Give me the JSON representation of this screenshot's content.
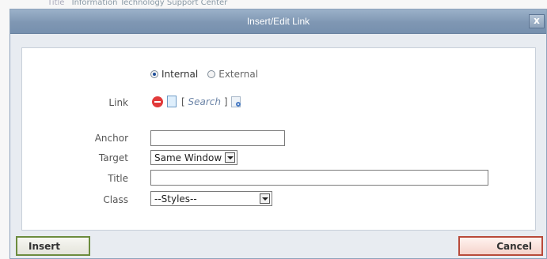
{
  "background": {
    "field_label": "Title",
    "field_value": "Information Technology Support Center"
  },
  "dialog": {
    "title": "Insert/Edit Link",
    "close_symbol": "x"
  },
  "link_type": {
    "options": [
      {
        "label": "Internal",
        "selected": true
      },
      {
        "label": "External",
        "selected": false
      }
    ]
  },
  "fields": {
    "link_label": "Link",
    "search_open": "[",
    "search_text": "Search",
    "search_close": "]",
    "anchor_label": "Anchor",
    "anchor_value": "",
    "target_label": "Target",
    "target_value": "Same Window",
    "title_label": "Title",
    "title_value": "",
    "class_label": "Class",
    "class_value": "--Styles--"
  },
  "buttons": {
    "insert": "Insert",
    "cancel": "Cancel"
  },
  "colors": {
    "titlebar": "#7f97b3",
    "insert_border": "#6c8c3e",
    "cancel_border": "#b84a3a",
    "remove_icon": "#e23a3a"
  }
}
